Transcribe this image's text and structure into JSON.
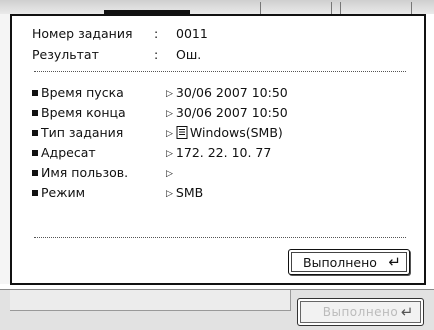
{
  "header": {
    "job_number_label": "Номер задания",
    "job_number_value": "0011",
    "result_label": "Результат",
    "result_value": "Ош."
  },
  "details": [
    {
      "label": "Время пуска",
      "value": "30/06 2007 10:50"
    },
    {
      "label": "Время конца",
      "value": "30/06 2007 10:50"
    },
    {
      "label": "Тип задания",
      "value": "Windows(SMB)",
      "icon": "document-icon"
    },
    {
      "label": "Адресат",
      "value": "172. 22. 10. 77"
    },
    {
      "label": "Имя пользов.",
      "value": ""
    },
    {
      "label": "Режим",
      "value": "SMB"
    }
  ],
  "dialog_button_label": "Выполнено",
  "background_button_label": "Выполнено",
  "separator": ":"
}
